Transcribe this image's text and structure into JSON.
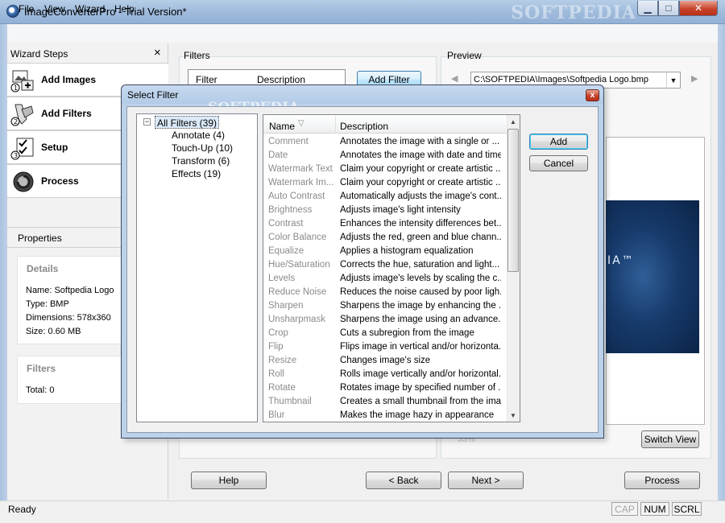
{
  "window": {
    "title": "ImageConverterPro - Trial Version*",
    "watermark": "SOFTPEDIA",
    "minimize_glyph": "▁",
    "maximize_glyph": "□",
    "close_glyph": "✕"
  },
  "menu": {
    "file": "File",
    "view": "View",
    "wizard": "Wizard",
    "help": "Help"
  },
  "wizard": {
    "title": "Wizard Steps",
    "close_glyph": "×",
    "steps": [
      {
        "label": "Add Images",
        "icon": "add-images-icon"
      },
      {
        "label": "Add Filters",
        "icon": "add-filters-icon"
      },
      {
        "label": "Setup",
        "icon": "setup-icon"
      },
      {
        "label": "Process",
        "icon": "process-icon"
      }
    ]
  },
  "properties": {
    "title": "Properties",
    "details_title": "Details",
    "name": "Name: Softpedia Logo",
    "type": "Type: BMP",
    "dimensions": "Dimensions: 578x360",
    "size": "Size: 0.60 MB",
    "filters_title": "Filters",
    "total": "Total: 0"
  },
  "filters_panel": {
    "title": "Filters",
    "col_filter": "Filter",
    "col_description": "Description",
    "add_filter_label": "Add Filter"
  },
  "preview": {
    "title": "Preview",
    "path": "C:\\SOFTPEDIA\\Images\\Softpedia Logo.bmp",
    "image_text": "IA™",
    "switch_view_label": "Switch View",
    "zoom_text": "33%",
    "nav_left": "◀",
    "nav_right": "▶",
    "combo_arrow": "▼"
  },
  "bottom_buttons": {
    "help": "Help",
    "back": "< Back",
    "next": "Next >",
    "process": "Process"
  },
  "status": {
    "text": "Ready",
    "cap": "CAP",
    "num": "NUM",
    "scrl": "SCRL"
  },
  "dialog": {
    "title": "Select Filter",
    "watermark": "SOFTPEDIA",
    "close_glyph": "x",
    "tree": {
      "expander_glyph": "−",
      "root": "All Filters (39)",
      "children": [
        "Annotate (4)",
        "Touch-Up (10)",
        "Transform (6)",
        "Effects (19)"
      ]
    },
    "columns": {
      "name": "Name",
      "description": "Description",
      "sort_glyph": "▽"
    },
    "rows": [
      {
        "name": "Comment",
        "description": "Annotates the image with a single or ..."
      },
      {
        "name": "Date",
        "description": "Annotates the image with date and time"
      },
      {
        "name": "Watermark Text",
        "description": "Claim your copyright or create artistic ..."
      },
      {
        "name": "Watermark Im...",
        "description": "Claim your copyright or create artistic ..."
      },
      {
        "name": "Auto Contrast",
        "description": "Automatically adjusts the image's cont..."
      },
      {
        "name": "Brightness",
        "description": "Adjusts image's light intensity"
      },
      {
        "name": "Contrast",
        "description": "Enhances the intensity differences bet..."
      },
      {
        "name": "Color Balance",
        "description": "Adjusts the red, green and blue chann..."
      },
      {
        "name": "Equalize",
        "description": "Applies a histogram equalization"
      },
      {
        "name": "Hue/Saturation",
        "description": "Corrects the hue, saturation and light..."
      },
      {
        "name": "Levels",
        "description": "Adjusts image's levels by scaling the c..."
      },
      {
        "name": "Reduce Noise",
        "description": "Reduces the noise caused by poor ligh..."
      },
      {
        "name": "Sharpen",
        "description": "Sharpens the image by enhancing the ..."
      },
      {
        "name": "Unsharpmask",
        "description": "Sharpens the image using an advance..."
      },
      {
        "name": "Crop",
        "description": "Cuts a subregion from the image"
      },
      {
        "name": "Flip",
        "description": "Flips image in vertical and/or horizonta..."
      },
      {
        "name": "Resize",
        "description": "Changes image's size"
      },
      {
        "name": "Roll",
        "description": "Rolls image vertically and/or horizontal..."
      },
      {
        "name": "Rotate",
        "description": "Rotates image by specified number of ..."
      },
      {
        "name": "Thumbnail",
        "description": "Creates a small thumbnail from the image"
      },
      {
        "name": "Blur",
        "description": "Makes the image hazy in appearance"
      }
    ],
    "scroll_up_glyph": "▲",
    "scroll_down_glyph": "▼",
    "add_label": "Add",
    "cancel_label": "Cancel"
  }
}
